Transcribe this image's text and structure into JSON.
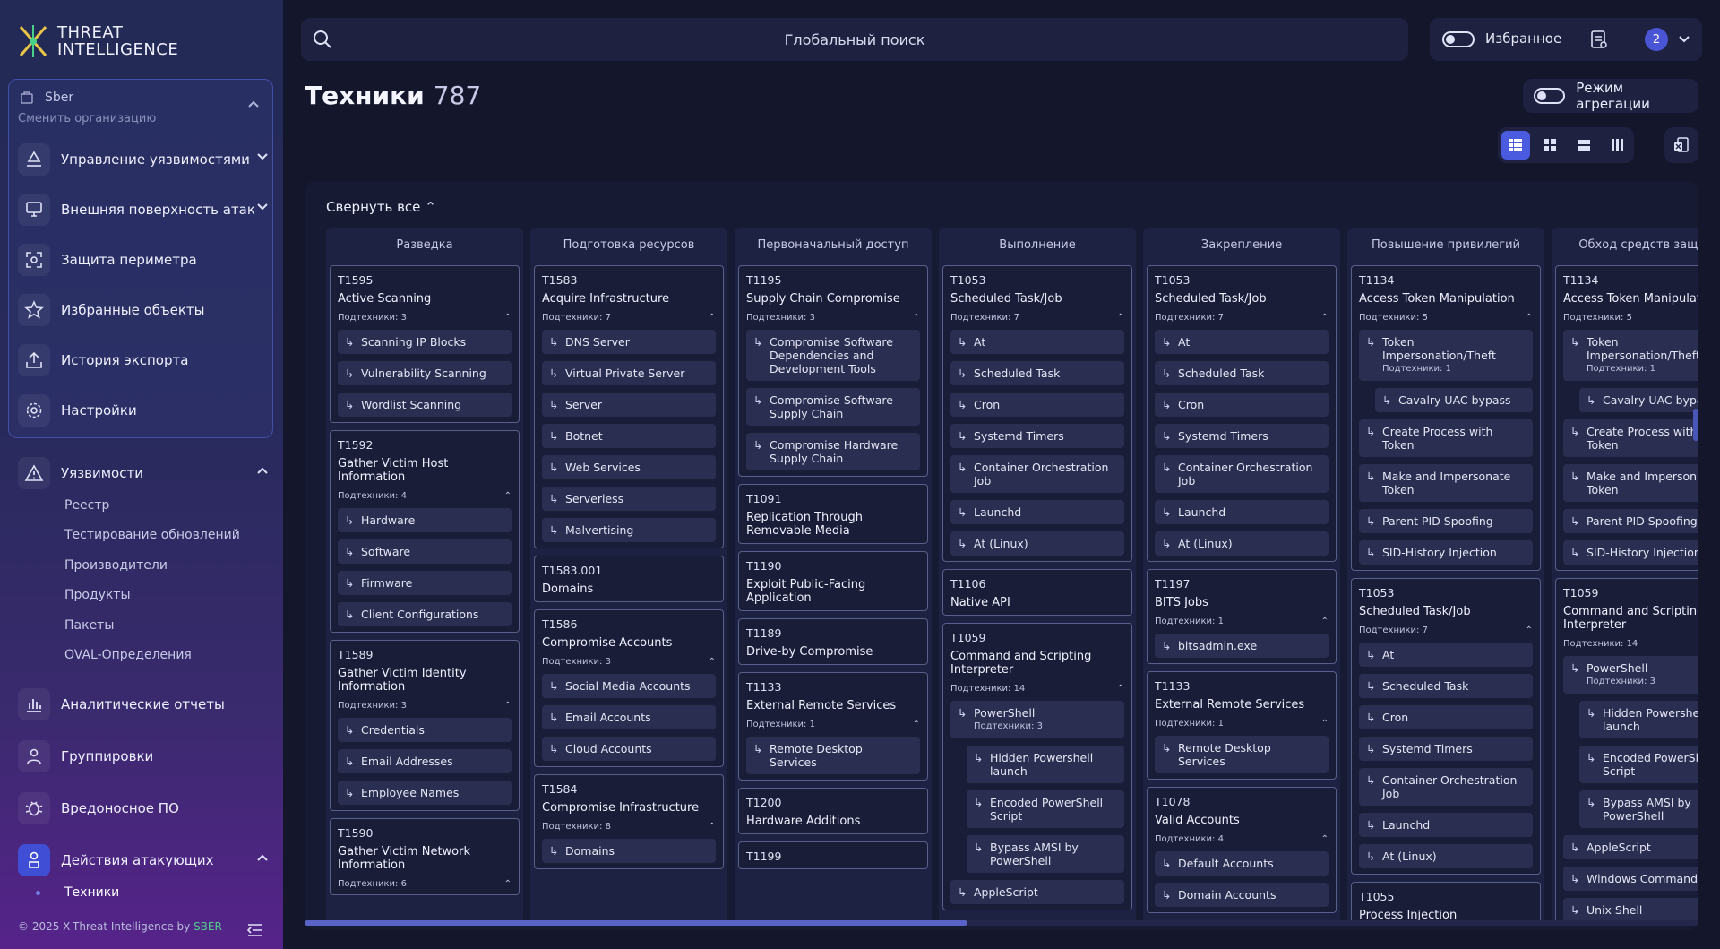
{
  "app": {
    "logo_line1": "THREAT",
    "logo_line2": "INTELLIGENCE"
  },
  "org": {
    "name": "Sber",
    "switch_label": "Сменить организацию"
  },
  "nav_org": [
    {
      "label": "Управление уязвимостями",
      "icon": "recycle-icon"
    },
    {
      "label": "Внешняя поверхность атак",
      "icon": "monitor-icon"
    },
    {
      "label": "Защита периметра",
      "icon": "scan-icon"
    },
    {
      "label": "Избранные объекты",
      "icon": "star-icon"
    },
    {
      "label": "История экспорта",
      "icon": "upload-icon"
    },
    {
      "label": "Настройки",
      "icon": "gear-icon"
    }
  ],
  "nav_main": {
    "vulns": {
      "label": "Уязвимости",
      "subitems": [
        "Реестр",
        "Тестирование обновлений",
        "Производители",
        "Продукты",
        "Пакеты",
        "OVAL-Определения"
      ]
    },
    "reports": "Аналитические отчеты",
    "groups": "Группировки",
    "malware": "Вредоносное ПО",
    "attacker": {
      "label": "Действия атакующих",
      "subitems": [
        "Техники"
      ]
    }
  },
  "footer": {
    "text": "© 2025 X-Threat Intelligence by ",
    "brand": "SBER"
  },
  "search": {
    "placeholder": "Глобальный поиск"
  },
  "topbar": {
    "favorites_label": "Избранное",
    "notif_count": "2"
  },
  "page": {
    "title": "Техники",
    "count": "787",
    "aggregation_label": "Режим агрегации",
    "collapse_all": "Свернуть все"
  },
  "columns": [
    {
      "title": "Разведка",
      "cards": [
        {
          "id": "T1595",
          "name": "Active Scanning",
          "sub": "Подтехники: 3",
          "items": [
            {
              "t": "Scanning IP Blocks"
            },
            {
              "t": "Vulnerability Scanning"
            },
            {
              "t": "Wordlist Scanning"
            }
          ]
        },
        {
          "id": "T1592",
          "name": "Gather Victim Host Information",
          "sub": "Подтехники: 4",
          "items": [
            {
              "t": "Hardware"
            },
            {
              "t": "Software"
            },
            {
              "t": "Firmware"
            },
            {
              "t": "Client Configurations"
            }
          ]
        },
        {
          "id": "T1589",
          "name": "Gather Victim Identity Information",
          "sub": "Подтехники: 3",
          "items": [
            {
              "t": "Credentials"
            },
            {
              "t": "Email Addresses"
            },
            {
              "t": "Employee Names"
            }
          ]
        },
        {
          "id": "T1590",
          "name": "Gather Victim Network Information",
          "sub": "Подтехники: 6",
          "items": []
        }
      ]
    },
    {
      "title": "Подготовка ресурсов",
      "cards": [
        {
          "id": "T1583",
          "name": "Acquire Infrastructure",
          "sub": "Подтехники: 7",
          "items": [
            {
              "t": "DNS Server"
            },
            {
              "t": "Virtual Private Server"
            },
            {
              "t": "Server"
            },
            {
              "t": "Botnet"
            },
            {
              "t": "Web Services"
            },
            {
              "t": "Serverless"
            },
            {
              "t": "Malvertising"
            }
          ]
        },
        {
          "id": "T1583.001",
          "name": "Domains",
          "sub": "",
          "items": []
        },
        {
          "id": "T1586",
          "name": "Compromise Accounts",
          "sub": "Подтехники: 3",
          "items": [
            {
              "t": "Social Media Accounts"
            },
            {
              "t": "Email Accounts"
            },
            {
              "t": "Cloud Accounts"
            }
          ]
        },
        {
          "id": "T1584",
          "name": "Compromise Infrastructure",
          "sub": "Подтехники: 8",
          "items": [
            {
              "t": "Domains"
            }
          ]
        }
      ]
    },
    {
      "title": "Первоначальный доступ",
      "cards": [
        {
          "id": "T1195",
          "name": "Supply Chain Compromise",
          "sub": "Подтехники: 3",
          "items": [
            {
              "t": "Compromise Software Dependencies and Development Tools"
            },
            {
              "t": "Compromise Software Supply Chain"
            },
            {
              "t": "Compromise Hardware Supply Chain"
            }
          ]
        },
        {
          "id": "T1091",
          "name": "Replication Through Removable Media",
          "sub": "",
          "items": []
        },
        {
          "id": "T1190",
          "name": "Exploit Public-Facing Application",
          "sub": "",
          "items": []
        },
        {
          "id": "T1189",
          "name": "Drive-by Compromise",
          "sub": "",
          "items": []
        },
        {
          "id": "T1133",
          "name": "External Remote Services",
          "sub": "Подтехники: 1",
          "items": [
            {
              "t": "Remote Desktop Services"
            }
          ]
        },
        {
          "id": "T1200",
          "name": "Hardware Additions",
          "sub": "",
          "items": []
        },
        {
          "id": "T1199",
          "name": "",
          "sub": "",
          "items": []
        }
      ]
    },
    {
      "title": "Выполнение",
      "cards": [
        {
          "id": "T1053",
          "name": "Scheduled Task/Job",
          "sub": "Подтехники: 7",
          "items": [
            {
              "t": "At"
            },
            {
              "t": "Scheduled Task"
            },
            {
              "t": "Cron"
            },
            {
              "t": "Systemd Timers"
            },
            {
              "t": "Container Orchestration Job"
            },
            {
              "t": "Launchd"
            },
            {
              "t": "At (Linux)"
            }
          ]
        },
        {
          "id": "T1106",
          "name": "Native API",
          "sub": "",
          "items": []
        },
        {
          "id": "T1059",
          "name": "Command and Scripting Interpreter",
          "sub": "Подтехники: 14",
          "items": [
            {
              "t": "PowerShell",
              "m": "Подтехники: 3"
            },
            {
              "t": "Hidden Powershell launch",
              "n": true
            },
            {
              "t": "Encoded PowerShell Script",
              "n": true
            },
            {
              "t": "Bypass AMSI by PowerShell",
              "n": true
            },
            {
              "t": "AppleScript"
            }
          ]
        }
      ]
    },
    {
      "title": "Закрепление",
      "cards": [
        {
          "id": "T1053",
          "name": "Scheduled Task/Job",
          "sub": "Подтехники: 7",
          "items": [
            {
              "t": "At"
            },
            {
              "t": "Scheduled Task"
            },
            {
              "t": "Cron"
            },
            {
              "t": "Systemd Timers"
            },
            {
              "t": "Container Orchestration Job"
            },
            {
              "t": "Launchd"
            },
            {
              "t": "At (Linux)"
            }
          ]
        },
        {
          "id": "T1197",
          "name": "BITS Jobs",
          "sub": "Подтехники: 1",
          "items": [
            {
              "t": "bitsadmin.exe"
            }
          ]
        },
        {
          "id": "T1133",
          "name": "External Remote Services",
          "sub": "Подтехники: 1",
          "items": [
            {
              "t": "Remote Desktop Services"
            }
          ]
        },
        {
          "id": "T1078",
          "name": "Valid Accounts",
          "sub": "Подтехники: 4",
          "items": [
            {
              "t": "Default Accounts"
            },
            {
              "t": "Domain Accounts"
            }
          ]
        }
      ]
    },
    {
      "title": "Повышение привилегий",
      "cards": [
        {
          "id": "T1134",
          "name": "Access Token Manipulation",
          "sub": "Подтехники: 5",
          "items": [
            {
              "t": "Token Impersonation/Theft",
              "m": "Подтехники: 1"
            },
            {
              "t": "Cavalry UAC bypass",
              "n": true
            },
            {
              "t": "Create Process with Token"
            },
            {
              "t": "Make and Impersonate Token"
            },
            {
              "t": "Parent PID Spoofing"
            },
            {
              "t": "SID-History Injection"
            }
          ]
        },
        {
          "id": "T1053",
          "name": "Scheduled Task/Job",
          "sub": "Подтехники: 7",
          "items": [
            {
              "t": "At"
            },
            {
              "t": "Scheduled Task"
            },
            {
              "t": "Cron"
            },
            {
              "t": "Systemd Timers"
            },
            {
              "t": "Container Orchestration Job"
            },
            {
              "t": "Launchd"
            },
            {
              "t": "At (Linux)"
            }
          ]
        },
        {
          "id": "T1055",
          "name": "Process Injection",
          "sub": "",
          "items": []
        }
      ]
    },
    {
      "title": "Обход средств защиты",
      "cards": [
        {
          "id": "T1134",
          "name": "Access Token Manipulation",
          "sub": "Подтехники: 5",
          "items": [
            {
              "t": "Token Impersonation/Theft",
              "m": "Подтехники: 1"
            },
            {
              "t": "Cavalry UAC bypass",
              "n": true
            },
            {
              "t": "Create Process with Token"
            },
            {
              "t": "Make and Impersonate Token"
            },
            {
              "t": "Parent PID Spoofing"
            },
            {
              "t": "SID-History Injection"
            }
          ]
        },
        {
          "id": "T1059",
          "name": "Command and Scripting Interpreter",
          "sub": "Подтехники: 14",
          "items": [
            {
              "t": "PowerShell",
              "m": "Подтехники: 3"
            },
            {
              "t": "Hidden Powershell launch",
              "n": true
            },
            {
              "t": "Encoded PowerShell Script",
              "n": true
            },
            {
              "t": "Bypass AMSI by PowerShell",
              "n": true
            },
            {
              "t": "AppleScript"
            },
            {
              "t": "Windows Command Shell"
            },
            {
              "t": "Unix Shell"
            }
          ]
        }
      ]
    }
  ],
  "colors": {
    "accent": "#4a5be0",
    "brand_green": "#4fd18b"
  }
}
